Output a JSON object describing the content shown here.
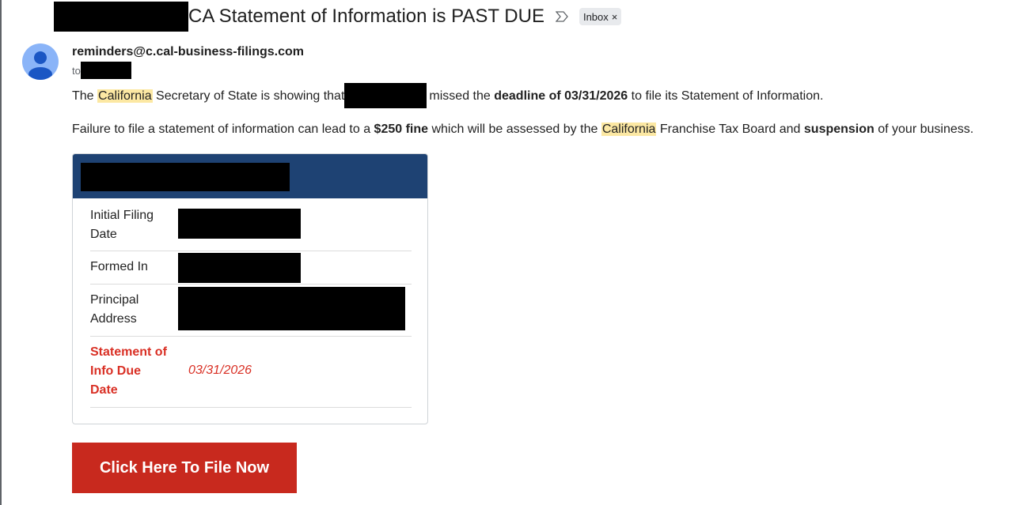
{
  "email": {
    "subject": "CA Statement of Information is PAST DUE",
    "label_chip": "Inbox",
    "label_chip_close": "×",
    "sender": "reminders@c.cal-business-filings.com",
    "to_prefix": "to"
  },
  "body": {
    "p1_part1": "The ",
    "p1_highlight": "California",
    "p1_part2": " Secretary of State is showing that",
    "p1_part3": "missed the ",
    "p1_bold": "deadline of 03/31/2026",
    "p1_part4": " to file its Statement of Information.",
    "p2_part1": "Failure to file a statement of information can lead to a ",
    "p2_bold1": "$250 fine",
    "p2_part2": " which will be assessed by the ",
    "p2_highlight": "California",
    "p2_part3": " Franchise Tax Board and ",
    "p2_bold2": "suspension",
    "p2_part4": " of your business."
  },
  "card": {
    "rows": [
      {
        "label": "Initial Filing Date"
      },
      {
        "label": "Formed In"
      },
      {
        "label": "Principal Address"
      },
      {
        "label": "Statement of Info Due Date",
        "value": "03/31/2026"
      }
    ]
  },
  "cta": {
    "label": "Click Here To File Now"
  },
  "colors": {
    "header_blue": "#1e4273",
    "cta_red": "#c8291e",
    "due_red": "#d93025",
    "highlight": "#fce8a3"
  },
  "icons": {
    "important": "importance-marker-icon",
    "avatar": "default-avatar-icon"
  }
}
